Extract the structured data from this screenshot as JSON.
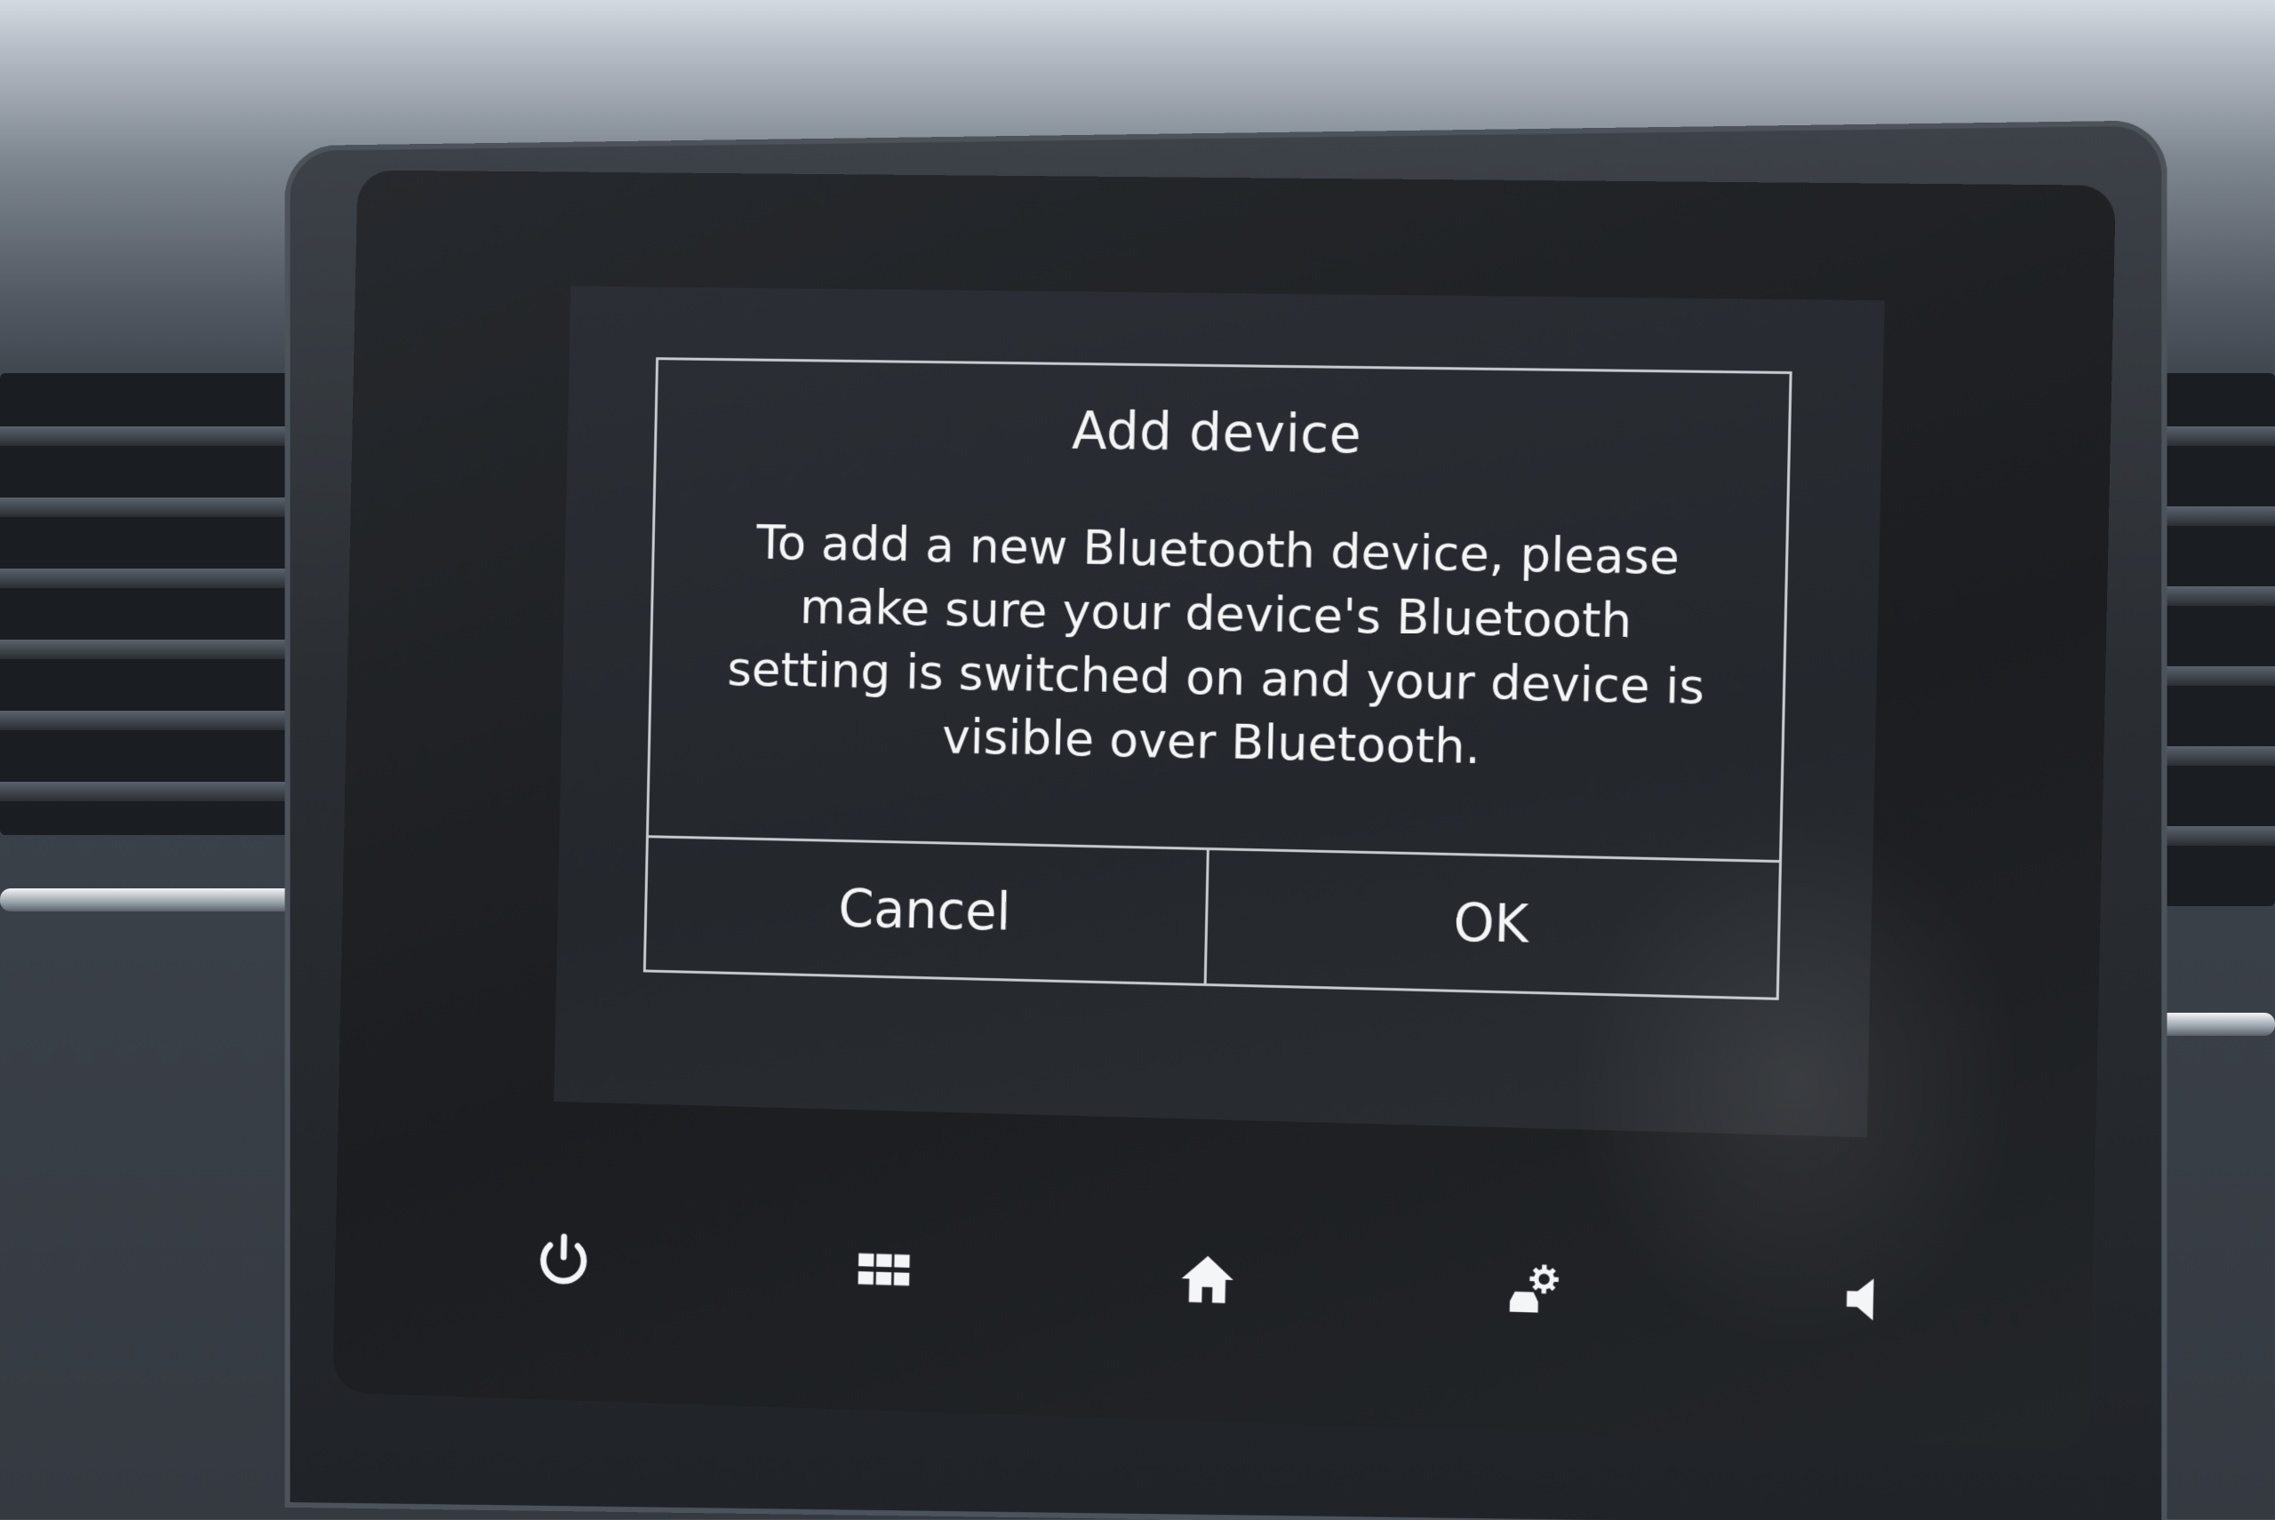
{
  "dialog": {
    "title": "Add device",
    "message": "To add a new Bluetooth device, please make sure your device's Bluetooth setting is switched on and your device is visible over Bluetooth.",
    "cancel_label": "Cancel",
    "ok_label": "OK"
  },
  "nav_bar": {
    "icons": [
      "power-icon",
      "app-grid-icon",
      "home-icon",
      "vehicle-settings-icon",
      "volume-icon"
    ]
  },
  "colors": {
    "screen_background": "#24282d",
    "text": "#f4f5f7",
    "dialog_border": "#c8ccd1"
  }
}
